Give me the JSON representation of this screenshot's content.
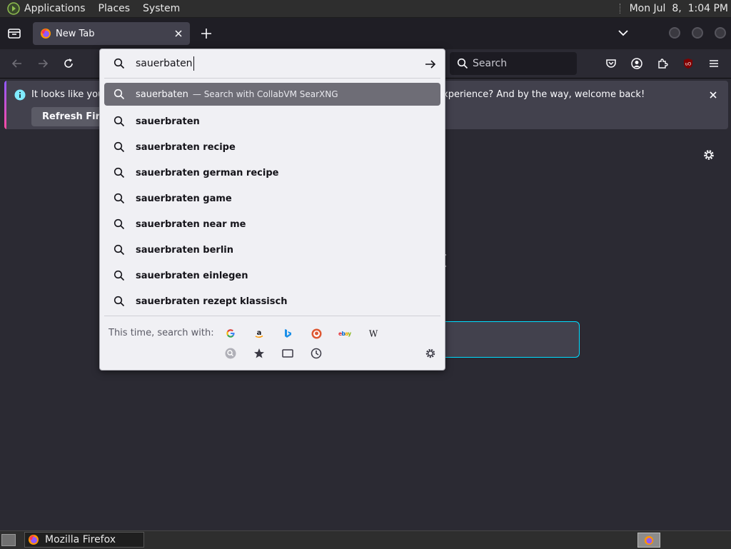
{
  "top_panel": {
    "menus": [
      "Applications",
      "Places",
      "System"
    ],
    "clock": "Mon Jul  8,  1:04 PM"
  },
  "tabs": [
    {
      "title": "New Tab"
    }
  ],
  "navbar": {
    "search_placeholder": "Search"
  },
  "notification": {
    "message_left": "It looks like you",
    "message_right": "xperience? And by the way, welcome back!",
    "button_label": "Refresh Firefox"
  },
  "urlbar": {
    "typed_text": "sauerbaten",
    "heuristic": {
      "text": "sauerbaten",
      "action": "— Search with CollabVM SearXNG"
    },
    "suggestions": [
      "sauerbraten",
      "sauerbraten recipe",
      "sauerbraten german recipe",
      "sauerbraten game",
      "sauerbraten near me",
      "sauerbraten berlin",
      "sauerbraten einlegen",
      "sauerbraten rezept klassisch"
    ],
    "oneoff_label": "This time, search with:",
    "engines": [
      "Google",
      "Amazon",
      "Bing",
      "DuckDuckGo",
      "eBay",
      "Wikipedia"
    ],
    "modes": [
      "search-mode-icon",
      "bookmarks-icon",
      "tabs-icon",
      "history-icon"
    ]
  },
  "taskbar": {
    "window_label": "Mozilla Firefox"
  },
  "colors": {
    "accent": "#00ddff",
    "selected_row": "#6e6d76",
    "panel_bg": "#f0f0f4"
  }
}
